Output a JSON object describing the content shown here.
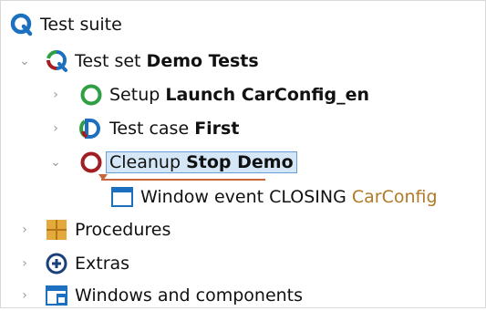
{
  "tree": {
    "root": {
      "prefix": "Test suite"
    },
    "test_set": {
      "prefix": "Test set",
      "name": "Demo Tests"
    },
    "setup": {
      "prefix": "Setup",
      "name": "Launch CarConfig_en"
    },
    "test_case": {
      "prefix": "Test case",
      "name": "First"
    },
    "cleanup": {
      "prefix": "Cleanup",
      "name": "Stop Demo"
    },
    "window_event": {
      "prefix": "Window event CLOSING",
      "target": "CarConfig"
    },
    "procedures": {
      "label": "Procedures"
    },
    "extras": {
      "label": "Extras"
    },
    "windows": {
      "label": "Windows and components"
    }
  },
  "arrows": {
    "collapsed": "›",
    "expanded": "⌄"
  },
  "colors": {
    "qf_blue": "#1d6fbf",
    "setup_green": "#2ea043",
    "cleanup_red": "#a11f23",
    "target_orange": "#b07a26",
    "procedures_orange": "#e3a93a",
    "selection_bg": "#d5e6f7"
  }
}
